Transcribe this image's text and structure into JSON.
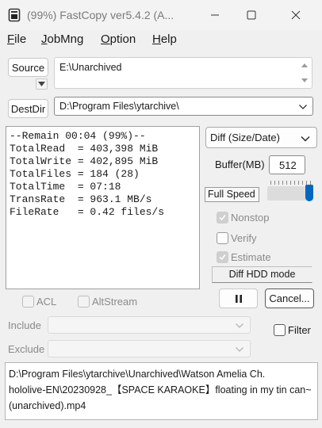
{
  "window": {
    "title": "(99%) FastCopy ver5.4.2 (A...",
    "icon": "fastcopy-app-icon"
  },
  "menu": {
    "items": [
      {
        "key": "F",
        "rest": "ile"
      },
      {
        "key": "J",
        "rest": "obMng"
      },
      {
        "key": "O",
        "rest": "ption"
      },
      {
        "key": "H",
        "rest": "elp"
      }
    ]
  },
  "source": {
    "button_label": "Source",
    "value": "E:\\Unarchived"
  },
  "destdir": {
    "button_label": "DestDir",
    "value": "D:\\Program Files\\ytarchive\\"
  },
  "status": {
    "lines": [
      "--Remain 00:04 (99%)--",
      "TotalRead  = 403,398 MiB",
      "TotalWrite = 402,895 MiB",
      "TotalFiles = 184 (28)",
      "TotalTime  = 07:18",
      "TransRate  = 963.1 MB/s",
      "FileRate   = 0.42 files/s"
    ]
  },
  "options": {
    "mode": "Diff (Size/Date)",
    "buffer_label": "Buffer(MB)",
    "buffer_value": "512",
    "speed_label": "Full Speed",
    "speed_level": 1.0,
    "nonstop": {
      "label": "Nonstop",
      "checked": true
    },
    "verify": {
      "label": "Verify",
      "checked": false
    },
    "estimate": {
      "label": "Estimate",
      "checked": true
    },
    "hdd_mode": "Diff HDD mode"
  },
  "controls": {
    "pause_symbol": "II",
    "cancel_label": "Cancel...",
    "acl_label": "ACL",
    "altstream_label": "AltStream",
    "include_label": "Include",
    "exclude_label": "Exclude",
    "filter_label": "Filter"
  },
  "current_file": {
    "lines": [
      "D:\\Program Files\\ytarchive\\Unarchived\\Watson Amelia Ch.",
      "hololive-EN\\20230928_【SPACE KARAOKE】floating in my tin can~",
      "(unarchived).mp4"
    ]
  }
}
